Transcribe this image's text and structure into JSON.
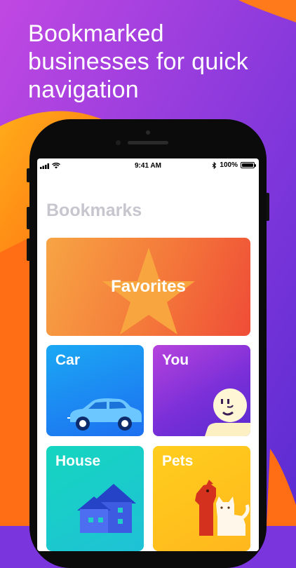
{
  "headline": "Bookmarked businesses for quick navigation",
  "status_bar": {
    "time": "9:41 AM",
    "battery": "100%"
  },
  "screen": {
    "title": "Bookmarks",
    "cards": {
      "favorites": "Favorites",
      "car": "Car",
      "you": "You",
      "house": "House",
      "pets": "Pets"
    }
  },
  "icons": [
    "signal-icon",
    "wifi-icon",
    "bluetooth-icon",
    "battery-icon",
    "star-icon",
    "car-icon",
    "face-icon",
    "house-icon",
    "dog-icon",
    "cat-icon"
  ],
  "colors": {
    "background_purple": "#7b35dc",
    "background_orange": "#ff7a1a",
    "favorites": "#f4783a",
    "car": "#1d8ff2",
    "you": "#8a32d9",
    "house": "#18cfc8",
    "pets": "#ffc31d"
  }
}
